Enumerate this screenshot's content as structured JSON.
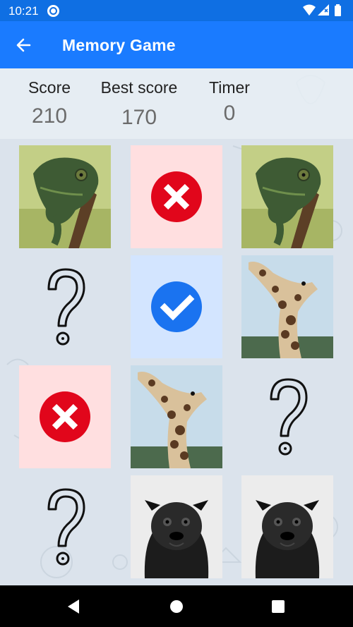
{
  "status_bar": {
    "time": "10:21",
    "app_icon": "circle-app-icon",
    "wifi_icon": "wifi-icon",
    "signal_icon": "signal-icon",
    "battery_icon": "battery-icon"
  },
  "app_bar": {
    "back_icon": "arrow-left-icon",
    "title": "Memory Game"
  },
  "scores": {
    "score_label": "Score",
    "score_value": "210",
    "best_label": "Best score",
    "best_value": "170",
    "timer_label": "Timer",
    "timer_value": "0"
  },
  "grid": {
    "rows": 4,
    "columns": 3,
    "tiles": [
      {
        "state": "revealed",
        "image": "chameleon"
      },
      {
        "state": "wrong",
        "icon": "x-circle-icon"
      },
      {
        "state": "revealed",
        "image": "chameleon"
      },
      {
        "state": "hidden",
        "icon": "question-mark-icon"
      },
      {
        "state": "correct",
        "icon": "check-circle-icon"
      },
      {
        "state": "revealed",
        "image": "giraffe"
      },
      {
        "state": "wrong",
        "icon": "x-circle-icon"
      },
      {
        "state": "revealed",
        "image": "giraffe"
      },
      {
        "state": "hidden",
        "icon": "question-mark-icon"
      },
      {
        "state": "hidden",
        "icon": "question-mark-icon"
      },
      {
        "state": "revealed",
        "image": "pug"
      },
      {
        "state": "revealed",
        "image": "pug"
      }
    ]
  },
  "colors": {
    "primary": "#1a7bff",
    "status_bar": "#0f6fe3",
    "wrong": "#e1061b",
    "wrong_bg": "#ffdfe0",
    "correct": "#1a73f0",
    "correct_bg": "#d3e5ff"
  },
  "nav_bar": {
    "back_icon": "triangle-back-icon",
    "home_icon": "circle-home-icon",
    "recents_icon": "square-recents-icon"
  }
}
